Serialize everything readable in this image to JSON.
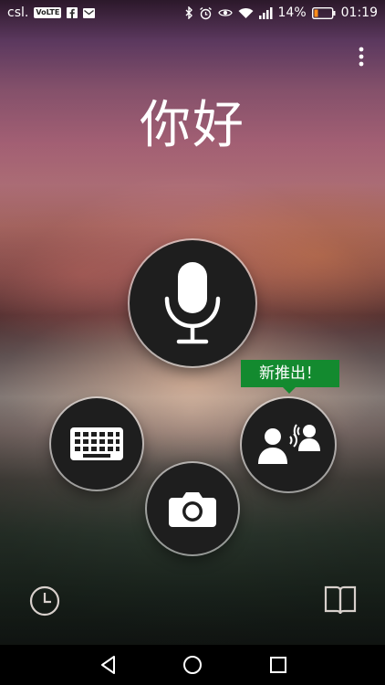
{
  "status_bar": {
    "carrier": "csl.",
    "volte_badge": "VoLTE",
    "battery_percent": "14%",
    "time": "01:19",
    "icons": [
      "volte-icon",
      "facebook-icon",
      "gmail-icon",
      "bluetooth-icon",
      "alarm-icon",
      "eye-icon",
      "wifi-icon",
      "signal-icon",
      "battery-icon"
    ]
  },
  "greeting": "你好",
  "tooltip": "新推出！",
  "buttons": {
    "microphone": "microphone-icon",
    "keyboard": "keyboard-icon",
    "camera": "camera-icon",
    "conversation": "conversation-icon",
    "history": "history-clock-icon",
    "phrasebook": "phrasebook-icon"
  },
  "nav": [
    "back-icon",
    "home-icon",
    "recents-icon"
  ],
  "colors": {
    "tooltip_bg": "#138a2f",
    "button_bg": "#1e1e1e"
  }
}
